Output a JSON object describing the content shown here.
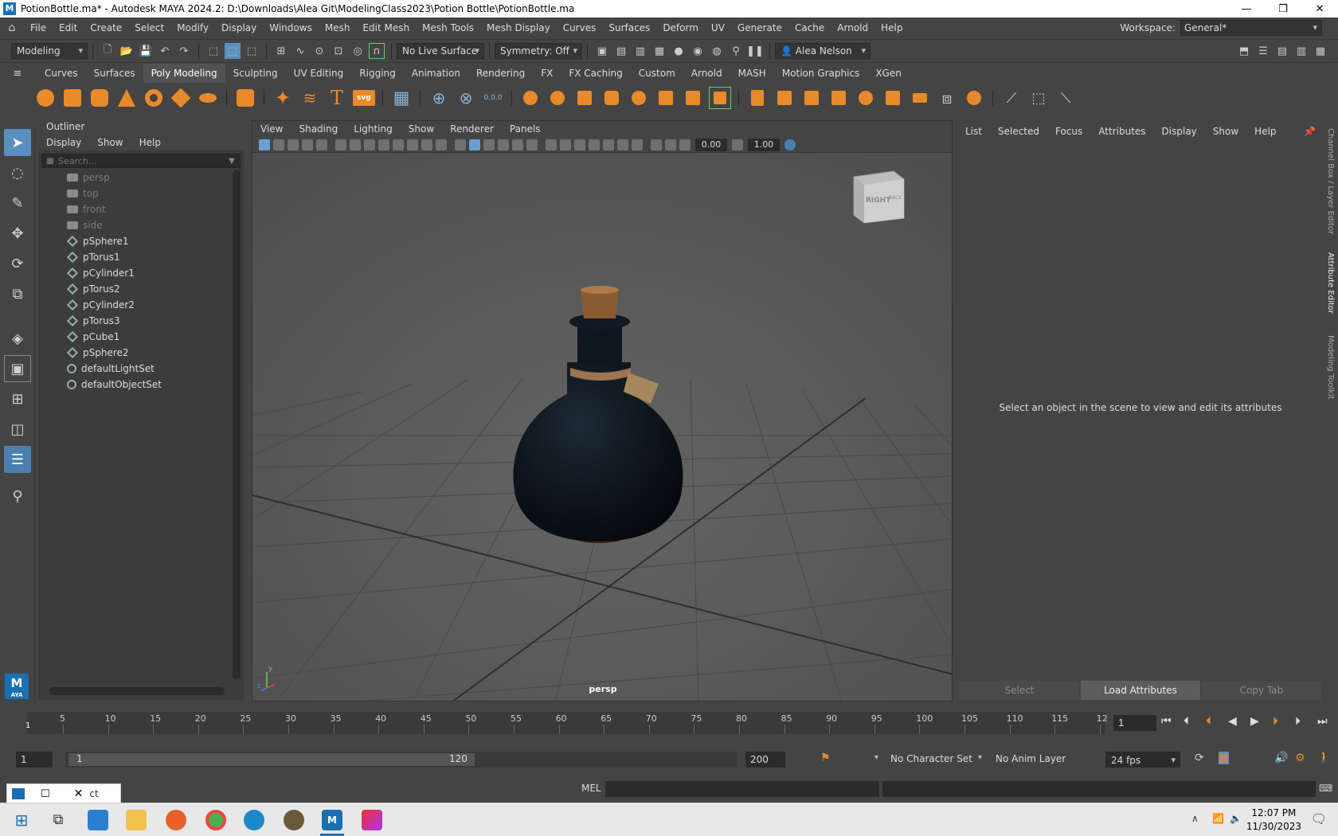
{
  "window": {
    "title": "PotionBottle.ma* - Autodesk MAYA 2024.2: D:\\Downloads\\Alea Git\\ModelingClass2023\\Potion Bottle\\PotionBottle.ma",
    "app_icon": "M",
    "minimize": "—",
    "maximize": "❐",
    "close": "✕"
  },
  "menubar": {
    "items": [
      "File",
      "Edit",
      "Create",
      "Select",
      "Modify",
      "Display",
      "Windows",
      "Mesh",
      "Edit Mesh",
      "Mesh Tools",
      "Mesh Display",
      "Curves",
      "Surfaces",
      "Deform",
      "UV",
      "Generate",
      "Cache",
      "Arnold",
      "Help"
    ],
    "workspace_label": "Workspace:",
    "workspace_value": "General*"
  },
  "statusline": {
    "menuset": "Modeling",
    "live_surface": "No Live Surface",
    "symmetry": "Symmetry: Off",
    "user": "Alea Nelson"
  },
  "shelf": {
    "tabs": [
      "Curves",
      "Surfaces",
      "Poly Modeling",
      "Sculpting",
      "UV Editing",
      "Rigging",
      "Animation",
      "Rendering",
      "FX",
      "FX Caching",
      "Custom",
      "Arnold",
      "MASH",
      "Motion Graphics",
      "XGen"
    ],
    "active_tab": "Poly Modeling",
    "text_tool_label": "T",
    "svg_tool_label": "svg",
    "coord_tool_label": "0,0,0"
  },
  "toolbox": {
    "logo_text": "M",
    "logo_sub": "AYA"
  },
  "outliner": {
    "title": "Outliner",
    "menus": [
      "Display",
      "Show",
      "Help"
    ],
    "search_placeholder": "Search...",
    "items": [
      {
        "label": "persp",
        "type": "camera"
      },
      {
        "label": "top",
        "type": "camera"
      },
      {
        "label": "front",
        "type": "camera"
      },
      {
        "label": "side",
        "type": "camera"
      },
      {
        "label": "pSphere1",
        "type": "mesh"
      },
      {
        "label": "pTorus1",
        "type": "mesh"
      },
      {
        "label": "pCylinder1",
        "type": "mesh"
      },
      {
        "label": "pTorus2",
        "type": "mesh"
      },
      {
        "label": "pCylinder2",
        "type": "mesh"
      },
      {
        "label": "pTorus3",
        "type": "mesh"
      },
      {
        "label": "pCube1",
        "type": "mesh"
      },
      {
        "label": "pSphere2",
        "type": "mesh"
      },
      {
        "label": "defaultLightSet",
        "type": "set"
      },
      {
        "label": "defaultObjectSet",
        "type": "set"
      }
    ]
  },
  "viewport": {
    "menus": [
      "View",
      "Shading",
      "Lighting",
      "Show",
      "Renderer",
      "Panels"
    ],
    "exposure": "0.00",
    "gamma": "1.00",
    "camera": "persp",
    "viewcube_right": "RIGHT",
    "viewcube_back": "BACK",
    "axis_y": "y",
    "axis_z": "z"
  },
  "attribute_editor": {
    "menus": [
      "List",
      "Selected",
      "Focus",
      "Attributes",
      "Display",
      "Show",
      "Help"
    ],
    "message": "Select an object in the scene to view and edit its attributes",
    "buttons": [
      "Select",
      "Load Attributes",
      "Copy Tab"
    ],
    "side_tabs": [
      "Channel Box / Layer Editor",
      "Attribute Editor",
      "Modeling Toolkit"
    ]
  },
  "timeline": {
    "ticks": [
      "5",
      "10",
      "15",
      "20",
      "25",
      "30",
      "35",
      "40",
      "45",
      "50",
      "55",
      "60",
      "65",
      "70",
      "75",
      "80",
      "85",
      "90",
      "95",
      "100",
      "105",
      "110",
      "115",
      "12"
    ],
    "current_marker": "1",
    "current_frame": "1"
  },
  "range": {
    "start": "1",
    "range_start": "1",
    "range_end": "120",
    "end": "200",
    "character_set": "No Character Set",
    "anim_layer": "No Anim Layer",
    "fps": "24 fps"
  },
  "cmdline": {
    "mode": "MEL",
    "feedback_fragment": "ct"
  },
  "taskbar": {
    "time": "12:07 PM",
    "date": "11/30/2023"
  }
}
